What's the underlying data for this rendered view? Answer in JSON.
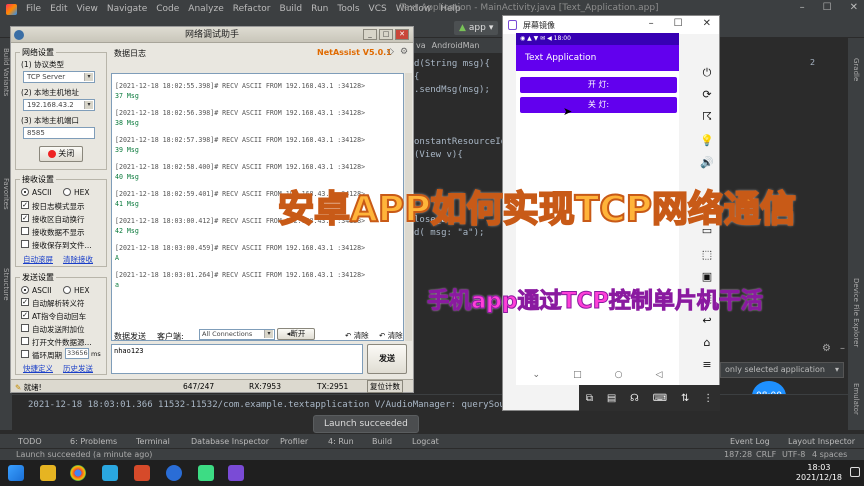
{
  "ide": {
    "menu": [
      "File",
      "Edit",
      "View",
      "Navigate",
      "Code",
      "Analyze",
      "Refactor",
      "Build",
      "Run",
      "Tools",
      "VCS",
      "Window",
      "Help"
    ],
    "title": "Text Application - MainActivity.java [Text_Application.app]",
    "run_config": "app",
    "editor_tabs": [
      "va",
      "AndroidMan"
    ],
    "code_lines": [
      "",
      "d(String msg){",
      " {",
      ".sendMsg(msg);",
      "",
      "",
      "",
      "onstantResourceId",
      "(View v){",
      "",
      "",
      "",
      "lose_btn:",
      "d( msg: \"a\");",
      ""
    ],
    "right_gutter": "2",
    "select_app": "only selected application",
    "logcat_line": "2021-12-18 18:03:01.366 11532-11532/com.example.textapplication V/AudioManager: querySoundE",
    "toast": "Launch succeeded",
    "tool_windows": [
      "TODO",
      "6: Problems",
      "Terminal",
      "Database Inspector",
      "Profiler",
      "4: Run",
      "Build",
      "Logcat",
      "Event Log",
      "Layout Inspector"
    ],
    "status_left": "Launch succeeded (a minute ago)",
    "status_right": [
      "187:28",
      "CRLF",
      "UTF-8",
      "4 spaces"
    ],
    "time_bubble": "08:00",
    "clock_time": "18:03",
    "clock_date": "2021/12/18",
    "left_strip_labels": [
      "Build Variants",
      "Favorites",
      "Structure"
    ],
    "right_strip_labels": [
      "Gradle",
      "Device File Explorer",
      "Emulator"
    ]
  },
  "netassist": {
    "title": "网络调试助手",
    "brand": "NetAssist V5.0.1",
    "net_settings": {
      "title": "网络设置",
      "protocol_label": "(1) 协议类型",
      "protocol_value": "TCP Server",
      "host_label": "(2) 本地主机地址",
      "host_value": "192.168.43.2",
      "port_label": "(3) 本地主机端口",
      "port_value": "8585",
      "close_button": "关闭"
    },
    "recv_settings": {
      "title": "接收设置",
      "ascii": "ASCII",
      "hex": "HEX",
      "options": [
        {
          "label": "按日志模式显示",
          "checked": true
        },
        {
          "label": "接收区自动换行",
          "checked": true
        },
        {
          "label": "接收数据不显示",
          "checked": false
        },
        {
          "label": "接收保存到文件...",
          "checked": false
        }
      ],
      "link_autoscroll": "自动滚屏",
      "link_clear": "清除接收"
    },
    "send_settings": {
      "title": "发送设置",
      "ascii": "ASCII",
      "hex": "HEX",
      "options": [
        {
          "label": "自动解析转义符",
          "checked": true
        },
        {
          "label": "AT指令自动回车",
          "checked": true
        },
        {
          "label": "自动发送附加位",
          "checked": false
        },
        {
          "label": "打开文件数据源...",
          "checked": false
        },
        {
          "label": "循环周期",
          "checked": false
        }
      ],
      "period_value": "33656",
      "period_unit": "ms",
      "link_shortcut": "快捷定义",
      "link_history": "历史发送"
    },
    "recv_tab": "数据日志",
    "recv_entries": [
      {
        "head": "[2021-12-18 18:02:55.398]# RECV ASCII FROM 192.168.43.1 :34128>",
        "msg": "37 Msg"
      },
      {
        "head": "[2021-12-18 18:02:56.398]# RECV ASCII FROM 192.168.43.1 :34128>",
        "msg": "38 Msg"
      },
      {
        "head": "[2021-12-18 18:02:57.398]# RECV ASCII FROM 192.168.43.1 :34128>",
        "msg": "39 Msg"
      },
      {
        "head": "[2021-12-18 18:02:58.400]# RECV ASCII FROM 192.168.43.1 :34128>",
        "msg": "40 Msg"
      },
      {
        "head": "[2021-12-18 18:02:59.401]# RECV ASCII FROM 192.168.43.1 :34128>",
        "msg": "41 Msg"
      },
      {
        "head": "[2021-12-18 18:03:00.412]# RECV ASCII FROM 192.168.43.1 :34128>",
        "msg": "42 Msg"
      },
      {
        "head": "[2021-12-18 18:03:00.459]# RECV ASCII FROM 192.168.43.1 :34128>",
        "msg": "A"
      },
      {
        "head": "[2021-12-18 18:03:01.264]# RECV ASCII FROM 192.168.43.1 :34128>",
        "msg": "a"
      }
    ],
    "send_tab": "数据发送",
    "client_label": "客户端:",
    "client_value": "All Connections",
    "disconnect": "断开",
    "clear1": "清除",
    "clear2": "清除",
    "send_text": "nhao123",
    "send_button": "发送",
    "status": {
      "ready": "就绪!",
      "count": "647/247",
      "rx": "RX:7953",
      "tx": "TX:2951",
      "reset": "复位计数"
    }
  },
  "phone_window": {
    "title": "屏幕镜像",
    "status_icons": "◉ ▲ ▼ ✉ ◀ 18:00",
    "app_title": "Text Application",
    "btn_on": "开 灯:",
    "btn_off": "关 灯:",
    "nav": [
      "⌄",
      "□",
      "○",
      "◁"
    ]
  },
  "captions": {
    "main": "安卓APP如何实现TCP网络通信",
    "sub": "手机app通过TCP控制单片机干活"
  },
  "colors": {
    "phone_accent": "#6200ee",
    "phone_dark": "#3700b3",
    "caption_main": "#ffb43a",
    "caption_sub": "#ff3fd8"
  }
}
